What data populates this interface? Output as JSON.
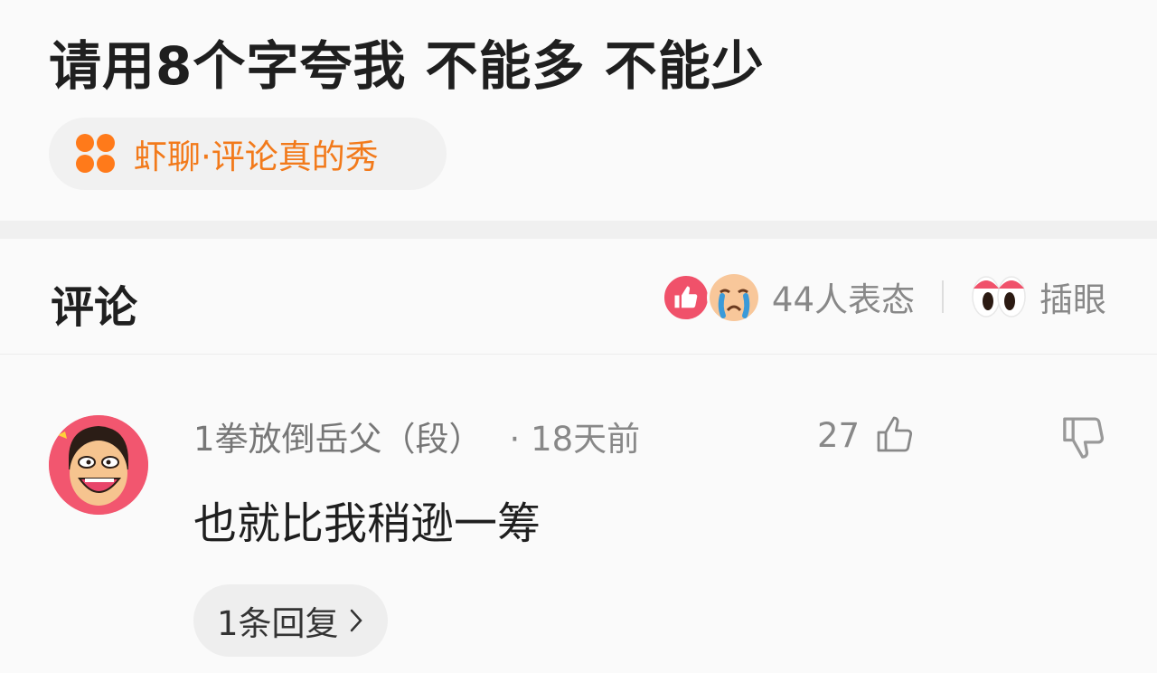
{
  "post": {
    "title": "请用8个字夸我 不能多 不能少",
    "circle_tag": {
      "label": "虾聊·评论真的秀",
      "icon": "clover-icon",
      "color": "#f27a1b"
    }
  },
  "comments_section": {
    "title": "评论",
    "reactions": {
      "icons": [
        "thumbs-up-icon",
        "crying-face-icon"
      ],
      "count_label": "44人表态",
      "eye_icon": "eyes-icon",
      "eye_label": "插眼"
    }
  },
  "comment": {
    "author": "1拳放倒岳父（段）",
    "time": "· 18天前",
    "like_count": "27",
    "text": "也就比我稍逊一筹",
    "reply_label": "1条回复"
  },
  "colors": {
    "accent_orange": "#f27a1b",
    "like_red": "#f0516a",
    "avatar_pink": "#f2566f"
  }
}
